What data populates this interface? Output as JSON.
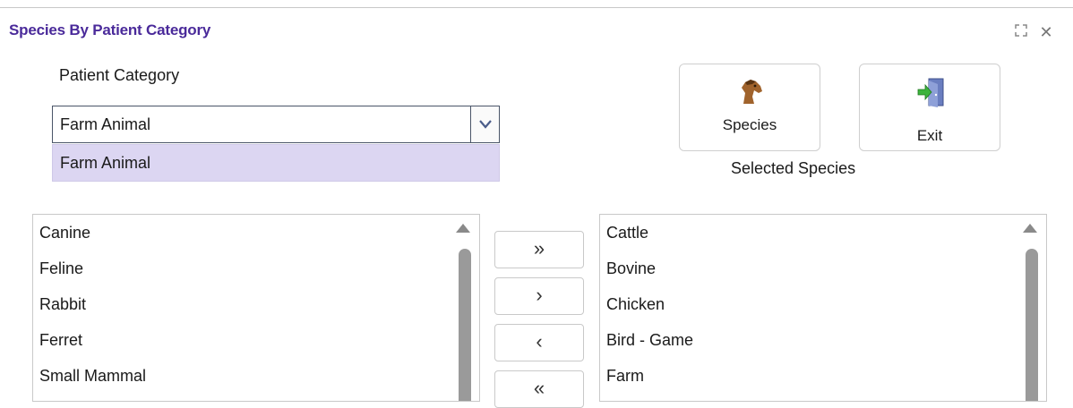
{
  "window": {
    "title": "Species By Patient Category",
    "controls": {
      "maximize": "⛶",
      "close": "✕"
    }
  },
  "patient_category": {
    "label": "Patient Category",
    "selected_value": "Farm Animal",
    "dropdown_options": [
      "Farm Animal"
    ],
    "dropdown_highlight_color": "#dcd6f2"
  },
  "toolbar": {
    "species_button_label": "Species",
    "species_icon": "horse-head-icon",
    "exit_button_label": "Exit",
    "exit_icon": "exit-door-icon"
  },
  "selected_species_label": "Selected Species",
  "available_list": {
    "items": [
      "Canine",
      "Feline",
      "Rabbit",
      "Ferret",
      "Small Mammal"
    ]
  },
  "selected_list": {
    "items": [
      "Cattle",
      "Bovine",
      "Chicken",
      "Bird - Game",
      "Farm"
    ]
  },
  "transfer_buttons": {
    "add_all": "»",
    "add_one": "›",
    "remove_one": "‹",
    "remove_all": "«"
  },
  "colors": {
    "title": "#4a2a9a",
    "scrollbar": "#9a9a9a"
  }
}
